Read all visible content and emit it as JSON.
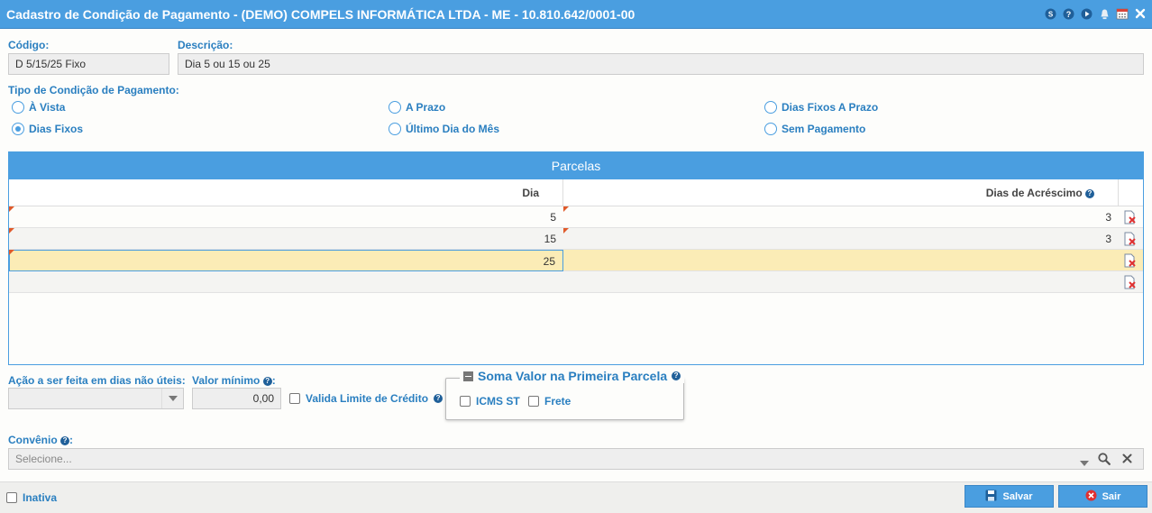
{
  "window": {
    "title": "Cadastro de Condição de Pagamento - (DEMO) COMPELS INFORMÁTICA LTDA - ME - 10.810.642/0001-00"
  },
  "codigo": {
    "label": "Código:",
    "value": "D 5/15/25 Fixo"
  },
  "descricao": {
    "label": "Descrição:",
    "value": "Dia 5 ou 15 ou 25"
  },
  "tipo": {
    "label": "Tipo de Condição de Pagamento:",
    "options": [
      {
        "label": "À Vista",
        "selected": false
      },
      {
        "label": "A Prazo",
        "selected": false
      },
      {
        "label": "Dias Fixos A Prazo",
        "selected": false
      },
      {
        "label": "Dias Fixos",
        "selected": true
      },
      {
        "label": "Último Dia do Mês",
        "selected": false
      },
      {
        "label": "Sem Pagamento",
        "selected": false
      }
    ]
  },
  "parcelas": {
    "title": "Parcelas",
    "columns": [
      "Dia",
      "Dias de Acréscimo"
    ],
    "rows": [
      {
        "dia": "5",
        "acrescimo": "3"
      },
      {
        "dia": "15",
        "acrescimo": "3"
      },
      {
        "dia": "25",
        "acrescimo": ""
      },
      {
        "dia": "",
        "acrescimo": ""
      }
    ]
  },
  "acao": {
    "label": "Ação a ser feita em dias não úteis:",
    "value": ""
  },
  "valor_minimo": {
    "label": "Valor mínimo",
    "value": "0,00"
  },
  "valida_limite": {
    "label": "Valida Limite de Crédito",
    "checked": false
  },
  "soma_valor": {
    "title": "Soma Valor na Primeira Parcela",
    "icms_st": {
      "label": "ICMS ST",
      "checked": false
    },
    "frete": {
      "label": "Frete",
      "checked": false
    }
  },
  "convenio": {
    "label": "Convênio",
    "placeholder": "Selecione..."
  },
  "inativa": {
    "label": "Inativa",
    "checked": false
  },
  "buttons": {
    "salvar": "Salvar",
    "sair": "Sair"
  },
  "colors": {
    "accent": "#4a9ee0",
    "label": "#2a7fc0",
    "selected_row": "#fbecb6",
    "danger": "#e03030"
  }
}
